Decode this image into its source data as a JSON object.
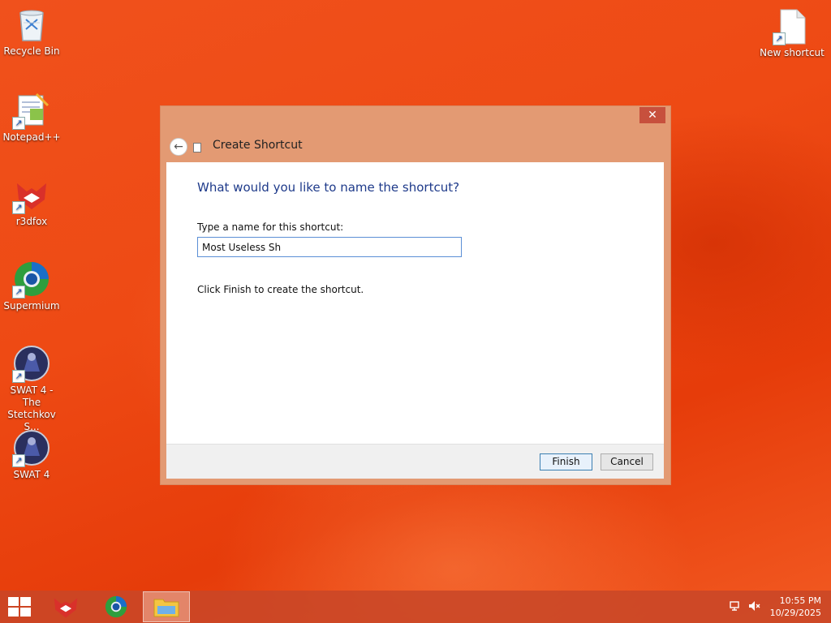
{
  "desktop": {
    "icons": [
      {
        "label": "Recycle Bin"
      },
      {
        "label": "Notepad++"
      },
      {
        "label": "r3dfox"
      },
      {
        "label": "Supermium"
      },
      {
        "label": "SWAT 4 - The\nStetchkov S..."
      },
      {
        "label": "SWAT 4"
      },
      {
        "label": "New shortcut"
      }
    ]
  },
  "dialog": {
    "title": "Create Shortcut",
    "close_glyph": "✕",
    "back_glyph": "←",
    "question": "What would you like to name the shortcut?",
    "name_label": "Type a name for this shortcut:",
    "name_value": "Most Useless Sh",
    "hint": "Click Finish to create the shortcut.",
    "finish_label": "Finish",
    "cancel_label": "Cancel"
  },
  "taskbar": {
    "clock_time": "10:55 PM",
    "clock_date": "10/29/2025"
  },
  "colors": {
    "desktop_bg": "#ee4a14",
    "dialog_frame": "#e39a73",
    "close_button": "#c7503d",
    "question_text": "#1e3a8a"
  }
}
